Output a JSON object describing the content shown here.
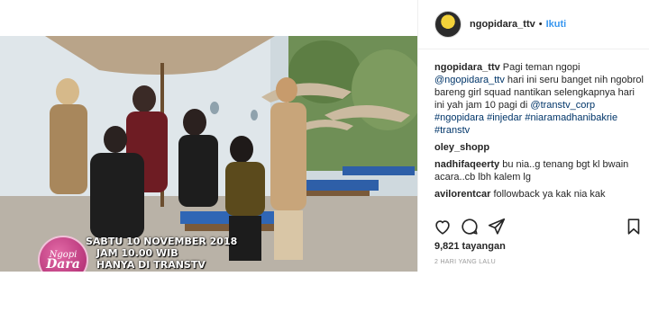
{
  "post": {
    "username": "ngopidara_ttv",
    "follow_label": "Ikuti",
    "separator": "•",
    "caption": {
      "user": "ngopidara_ttv",
      "text_1": "Pagi teman ngopi",
      "mention": "@ngopidara_ttv",
      "text_2": "hari ini seru banget nih ngobrol bareng girl squad nantikan selengkapnya hari ini yah jam 10 pagi di",
      "mention_2": "@transtv_corp",
      "hashtags": [
        "#ngopidara",
        "#injedar",
        "#niaramadhanibakrie",
        "#transtv"
      ]
    },
    "comments": [
      {
        "user": "oley_shopp",
        "text": ""
      },
      {
        "user": "nadhifaqeerty",
        "text": "bu nia..g tenang bgt kl bwain acara..cb lbh kalem lg"
      },
      {
        "user": "avilorentcar",
        "text": "followback ya kak nia kak"
      }
    ],
    "views_count": "9,821",
    "views_label": "tayangan",
    "time_ago": "2 HARI YANG LALU"
  },
  "media": {
    "overlay_line1": "SABTU 10 NOVEMBER 2018",
    "overlay_line2": "JAM 10.00 WIB",
    "overlay_line3": "HANYA DI TRANSTV",
    "logo_top": "Ngopi",
    "logo_bottom": "Dara"
  },
  "icons": {
    "like": "heart-icon",
    "comment": "comment-icon",
    "share": "share-icon",
    "save": "bookmark-icon"
  },
  "colors": {
    "link": "#3897f0",
    "hashtag": "#003569",
    "muted": "#999999",
    "logo_pink": "#c2338a"
  }
}
